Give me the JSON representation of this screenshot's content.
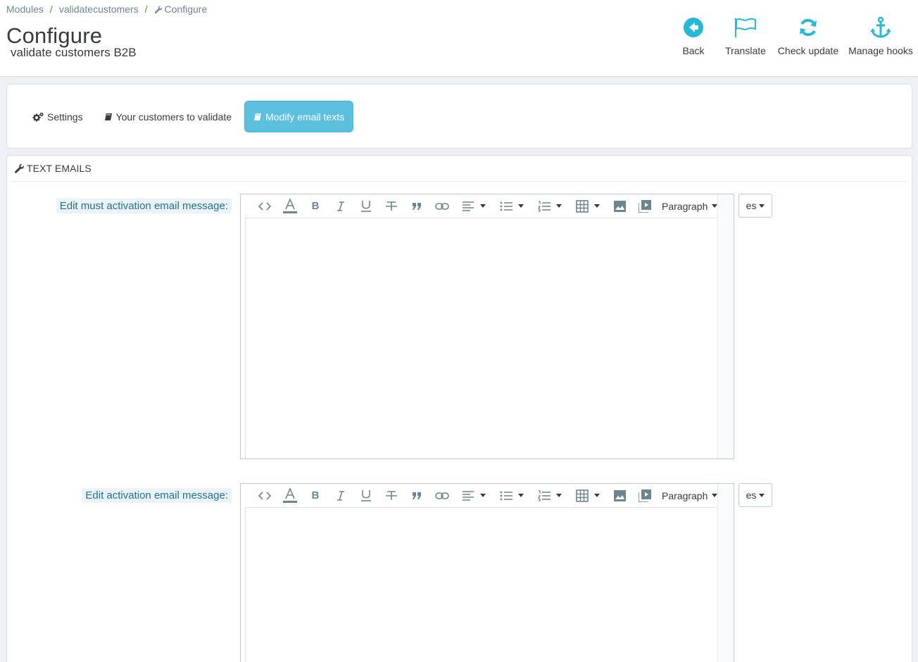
{
  "breadcrumb": {
    "items": [
      "Modules",
      "validatecustomers",
      "Configure"
    ]
  },
  "header": {
    "title": "Configure",
    "subtitle": "validate customers B2B"
  },
  "toolbar": {
    "back": "Back",
    "translate": "Translate",
    "check_update": "Check update",
    "manage_hooks": "Manage hooks"
  },
  "tabs": [
    {
      "label": "Settings",
      "icon": "cogs-icon"
    },
    {
      "label": "Your customers to validate",
      "icon": "book-icon"
    },
    {
      "label": "Modify email texts",
      "icon": "book-icon",
      "active": true
    }
  ],
  "panel": {
    "heading": "TEXT EMAILS"
  },
  "fields": [
    {
      "label": "Edit must activation email message:",
      "format": "Paragraph",
      "lang": "es"
    },
    {
      "label": "Edit activation email message:",
      "format": "Paragraph",
      "lang": "es"
    }
  ],
  "colors": {
    "accent": "#25b9d7",
    "active_tab": "#5bc0de",
    "icon_gray": "#6c868e"
  }
}
